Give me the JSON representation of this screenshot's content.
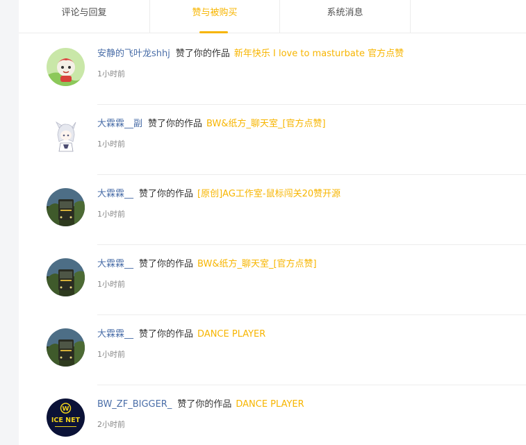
{
  "tabs": [
    {
      "label": "评论与回复"
    },
    {
      "label": "赞与被购买"
    },
    {
      "label": "系统消息"
    }
  ],
  "notifications": [
    {
      "user": "安静的飞叶龙shhj",
      "verb": "赞了你的作品",
      "work": "新年快乐 I love to masturbate 官方点赞",
      "time": "1小时前",
      "avatar_icon": "cartoon-character-avatar"
    },
    {
      "user": "大霖霖__副",
      "verb": "赞了你的作品",
      "work": "BW&纸方_聊天室_[官方点赞]",
      "time": "1小时前",
      "avatar_icon": "anime-character-avatar"
    },
    {
      "user": "大霖霖__",
      "verb": "赞了你的作品",
      "work": "[原创]AG工作室-鼠标闯关20赞开源",
      "time": "1小时前",
      "avatar_icon": "bus-photo-avatar"
    },
    {
      "user": "大霖霖__",
      "verb": "赞了你的作品",
      "work": "BW&纸方_聊天室_[官方点赞]",
      "time": "1小时前",
      "avatar_icon": "bus-photo-avatar"
    },
    {
      "user": "大霖霖__",
      "verb": "赞了你的作品",
      "work": "DANCE PLAYER",
      "time": "1小时前",
      "avatar_icon": "bus-photo-avatar"
    },
    {
      "user": "BW_ZF_BIGGER_",
      "verb": "赞了你的作品",
      "work": "DANCE PLAYER",
      "time": "2小时前",
      "avatar_icon": "ice-net-logo-avatar",
      "avatar_text": "ICE NET"
    }
  ]
}
